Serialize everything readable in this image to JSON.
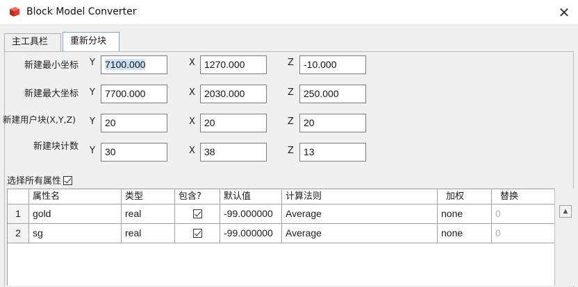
{
  "window": {
    "title": "Block Model Converter",
    "close_glyph": "✕",
    "icon": "app-icon"
  },
  "tabs": [
    {
      "label": "主工具栏"
    },
    {
      "label": "重新分块"
    }
  ],
  "form": {
    "rows": [
      {
        "label": "新建最小坐标",
        "y": "7100.000",
        "x": "1270.000",
        "z": "-10.000"
      },
      {
        "label": "新建最大坐标",
        "y": "7700.000",
        "x": "2030.000",
        "z": "250.000"
      },
      {
        "label": "新建用户块(X,Y,Z)",
        "y": "20",
        "x": "20",
        "z": "20"
      },
      {
        "label": "新建块计数",
        "y": "30",
        "x": "38",
        "z": "13"
      }
    ],
    "axis_y": "Y",
    "axis_x": "X",
    "axis_z": "Z"
  },
  "select_all": {
    "label": "选择所有属性",
    "checked": true
  },
  "table": {
    "headers": [
      "属性名",
      "类型",
      "包含?",
      "默认值",
      "计算法则",
      "加权",
      "替换"
    ],
    "rows": [
      {
        "num": "1",
        "name": "gold",
        "type": "real",
        "include": true,
        "default": "-99.000000",
        "method": "Average",
        "weight": "none",
        "replace": "0"
      },
      {
        "num": "2",
        "name": "sg",
        "type": "real",
        "include": true,
        "default": "-99.000000",
        "method": "Average",
        "weight": "none",
        "replace": "0"
      }
    ]
  },
  "scroll_up_glyph": "▲"
}
